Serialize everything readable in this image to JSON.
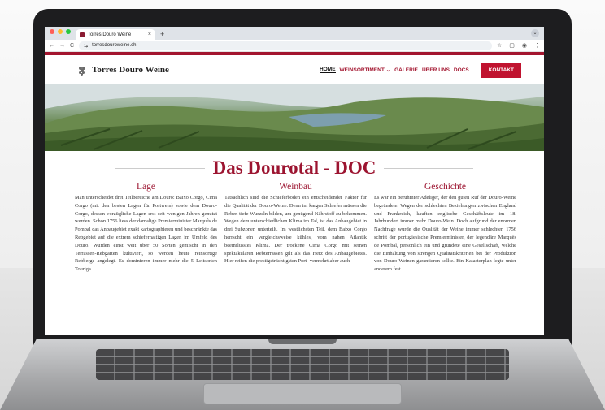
{
  "browser": {
    "tab_title": "Torres Douro Weine",
    "tab_close": "×",
    "new_tab": "+",
    "url": "torresdouroweine.ch",
    "nav_back": "←",
    "nav_forward": "→",
    "nav_reload": "C"
  },
  "site": {
    "brand": "Torres Douro Weine",
    "nav": {
      "home": "HOME",
      "weinsortiment": "WEINSORTIMENT",
      "galerie": "GALERIE",
      "ueber_uns": "ÜBER UNS",
      "docs": "DOCS",
      "kontakt": "KONTAKT"
    },
    "headline": "Das Dourotal - DOC",
    "columns": [
      {
        "title": "Lage",
        "text": "Man unterscheidet drei Teilbereiche am Douro: Baixo Corgo, Cima Corgo (mit den besten Lagen für Portwein) sowie dem Douro-Corgo, dessen vorzügliche Lagen erst seit wenigen Jahren genutzt werden. Schon 1756 liess der damalige Premierminister Marquês de Pombal das Anbaugebiet exakt kartographieren und beschränkte das Rebgebiet auf die extrem schieferhaltigen Lagen im Umfeld des Douro. Wurden einst weit über 50 Sorten gemischt in den Terrassen-Rebgärten kultiviert, so werden heute reinsortige Rebberge angelegt. Es dominieren immer mehr die 5 Leitsorten Touriga"
      },
      {
        "title": "Weinbau",
        "text": "Tatsächlich sind die Schieferböden ein entscheidender Faktor für die Qualität der Douro-Weine. Denn im kargen Schiefer müssen die Reben tiefe Wurzeln bilden, um genügend Nährstoff zu bekommen. Wegen dem unterschiedlichen Klima im Tal, ist das Anbaugebiet in drei Subzonen unterteilt. Im westlichsten Teil, dem Baixo Corgo herrscht ein vergleichsweise kühles, vom nahen Atlantik beeinflusstes Klima. Der trockene Cima Corgo mit seinen spektakulären Rebterrassen gilt als das Herz des Anbaugebietes. Hier reifen die prestigeträchtigsten Port- vermehrt aber auch"
      },
      {
        "title": "Geschichte",
        "text": "Es war ein berühmter Adeliger, der den guten Ruf der Douro-Weine begründete. Wegen der schlechten Beziehungen zwischen England und Frankreich, kauften englische Geschäftsleute im 18. Jahrhundert immer mehr Douro-Wein. Doch aufgrund der enormen Nachfrage wurde die Qualität der Weine immer schlechter. 1756 schritt der portugiesische Premierminister, der legendäre Marquês de Pombal, persönlich ein und gründete eine Gesellschaft, welche die Einhaltung von strengen Qualitätskriterien bei der Produktion von Douro-Weinen garantieren sollte. Ein Katasterplan legte unter anderem fest"
      }
    ]
  },
  "colors": {
    "brand_red": "#a3152f",
    "headline_red": "#9c1430",
    "cta_red": "#c0132f"
  }
}
